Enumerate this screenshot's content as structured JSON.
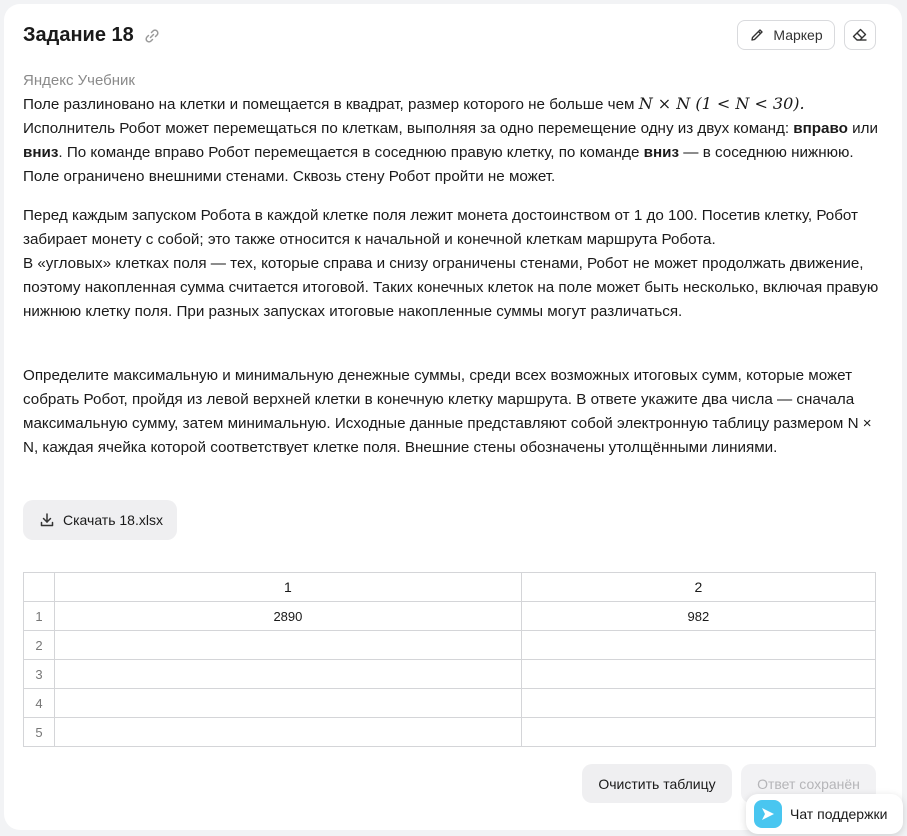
{
  "task": {
    "title": "Задание 18",
    "source": "Яндекс Учебник"
  },
  "toolbar": {
    "marker_label": "Маркер"
  },
  "paragraph1": {
    "seg1": "Поле разлиновано на клетки и помещается в квадрат, размер которого не больше чем ",
    "math": "N × N (1 < N < 30).",
    "seg2": " Исполнитель Робот может перемещаться по клеткам, выполняя за одно перемещение одну из двух команд: ",
    "cmd_right": "вправо",
    "seg3": " или ",
    "cmd_down": "вниз",
    "seg4": ". По команде вправо Робот перемещается в соседнюю правую клетку, по команде ",
    "cmd_down2": "вниз",
    "seg5": " — в соседнюю нижнюю. Поле ограничено внешними стенами. Сквозь стену Робот пройти не может."
  },
  "paragraph2": {
    "line1": "Перед каждым запуском Робота в каждой клетке поля лежит монета достоинством от 1 до 100. Посетив клетку, Робот забирает монету с собой; это также относится к начальной и конечной клеткам маршрута Робота.",
    "line2": "В «угловых» клетках поля — тех, которые справа и снизу ограничены стенами, Робот не может продолжать движение, поэтому накопленная сумма считается итоговой. Таких конечных клеток на поле может быть несколько, включая правую нижнюю клетку поля. При разных запусках итоговые накопленные суммы могут различаться."
  },
  "paragraph3": "Определите максимальную и минимальную денежные суммы, среди всех возможных итоговых сумм, которые может собрать Робот, пройдя из левой верхней клетки в конечную клетку маршрута. В ответе укажите два числа — сначала максимальную сумму, затем минимальную. Исходные данные представляют собой электронную таблицу размером N × N, каждая ячейка которой соответствует клетке поля. Внешние стены обозначены утолщёнными линиями.",
  "download": {
    "label": "Скачать 18.xlsx"
  },
  "answer_table": {
    "columns": [
      "1",
      "2"
    ],
    "rows": [
      {
        "num": "1",
        "cells": [
          "2890",
          "982"
        ]
      },
      {
        "num": "2",
        "cells": [
          "",
          ""
        ]
      },
      {
        "num": "3",
        "cells": [
          "",
          ""
        ]
      },
      {
        "num": "4",
        "cells": [
          "",
          ""
        ]
      },
      {
        "num": "5",
        "cells": [
          "",
          ""
        ]
      }
    ]
  },
  "actions": {
    "clear_label": "Очистить таблицу",
    "saved_label": "Ответ сохранён"
  },
  "chat": {
    "label": "Чат поддержки"
  },
  "colors": {
    "background": "#f2f3f5",
    "card": "#ffffff",
    "button_gray": "#efeff1",
    "chat_accent": "#49c6f0"
  }
}
